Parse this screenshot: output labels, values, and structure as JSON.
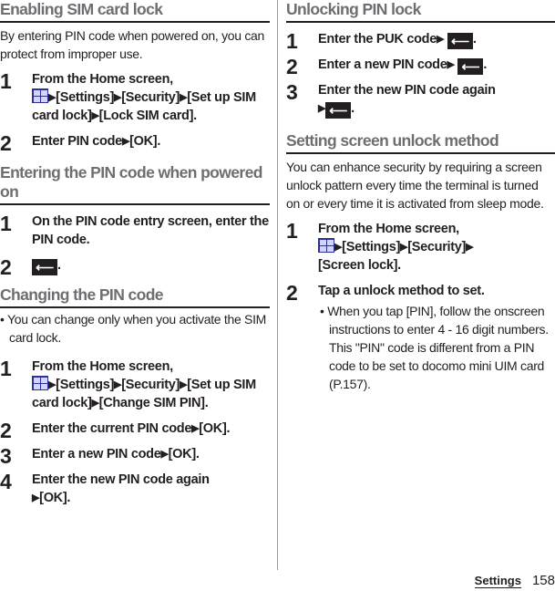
{
  "left": {
    "sec1": {
      "heading": "Enabling SIM card lock",
      "intro": "By entering PIN code when powered on, you can protect from improper use.",
      "steps": [
        {
          "num": "1",
          "a": "From the Home screen,",
          "b": "[Settings]",
          "c": "[Security]",
          "d": "[Set up SIM card lock]",
          "e": "[Lock SIM card]."
        },
        {
          "num": "2",
          "a": "Enter PIN code",
          "b": "[OK]."
        }
      ]
    },
    "sec2": {
      "heading": "Entering the PIN code when powered on",
      "steps": [
        {
          "num": "1",
          "a": "On the PIN code entry screen, enter the PIN code."
        },
        {
          "num": "2",
          "a": "."
        }
      ]
    },
    "sec3": {
      "heading": "Changing the PIN code",
      "note": "You can change only when you activate the SIM card lock.",
      "steps": [
        {
          "num": "1",
          "a": "From the Home screen,",
          "b": "[Settings]",
          "c": "[Security]",
          "d": "[Set up SIM card lock]",
          "e": "[Change SIM PIN]."
        },
        {
          "num": "2",
          "a": "Enter the current PIN code",
          "b": "[OK]."
        },
        {
          "num": "3",
          "a": "Enter a new PIN code",
          "b": "[OK]."
        },
        {
          "num": "4",
          "a": "Enter the new PIN code again",
          "b": "[OK]."
        }
      ]
    }
  },
  "right": {
    "sec1": {
      "heading": "Unlocking PIN lock",
      "steps": [
        {
          "num": "1",
          "a": "Enter the PUK code"
        },
        {
          "num": "2",
          "a": "Enter a new PIN code"
        },
        {
          "num": "3",
          "a": "Enter the new PIN code again"
        }
      ]
    },
    "sec2": {
      "heading": "Setting screen unlock method",
      "intro": "You can enhance security by requiring a screen unlock pattern every time the terminal is turned on or every time it is activated from sleep mode.",
      "steps": [
        {
          "num": "1",
          "a": "From the Home screen,",
          "b": "[Settings]",
          "c": "[Security]",
          "d": "[Screen lock]."
        },
        {
          "num": "2",
          "a": "Tap a unlock method to set.",
          "note": "When you tap [PIN], follow the onscreen instructions to enter 4 - 16 digit numbers. This \"PIN\" code is different from a PIN code to be set to docomo mini UIM card (P.157)."
        }
      ]
    }
  },
  "glyphs": {
    "arrow": "▶",
    "enter": "⟵",
    "bullet": "•",
    "period": "."
  },
  "footer": {
    "section": "Settings",
    "page": "158"
  }
}
